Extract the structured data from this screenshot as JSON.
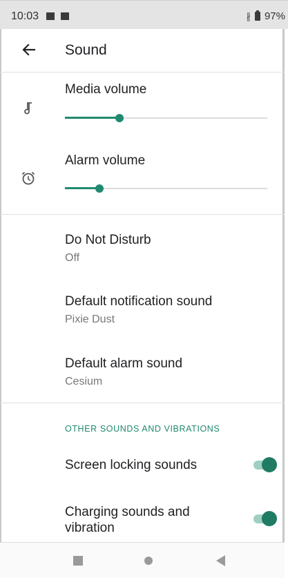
{
  "status_bar": {
    "time": "10:03",
    "battery": "97%"
  },
  "app_bar": {
    "title": "Sound"
  },
  "media_volume": {
    "label": "Media volume",
    "level": 0.27
  },
  "alarm_volume": {
    "label": "Alarm volume",
    "level": 0.17
  },
  "items": [
    {
      "label": "Do Not Disturb",
      "value": "Off"
    },
    {
      "label": "Default notification sound",
      "value": "Pixie Dust"
    },
    {
      "label": "Default alarm sound",
      "value": "Cesium"
    }
  ],
  "section_header": "OTHER SOUNDS AND VIBRATIONS",
  "toggles": [
    {
      "label": "Screen locking sounds",
      "on": true
    },
    {
      "label_line1": "Charging sounds and",
      "label_line2": "vibration",
      "on": true
    }
  ],
  "colors": {
    "accent": "#1f8a70"
  }
}
